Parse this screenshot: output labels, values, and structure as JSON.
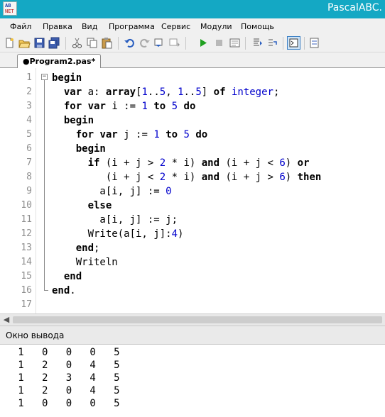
{
  "window": {
    "title": "PascalABC.",
    "icon_text_top": "AB",
    "icon_text_bottom": "NET"
  },
  "menu": [
    {
      "label": "Файл"
    },
    {
      "label": "Правка"
    },
    {
      "label": "Вид"
    },
    {
      "label": "Программа"
    },
    {
      "label": "Сервис"
    },
    {
      "label": "Модули"
    },
    {
      "label": "Помощь"
    }
  ],
  "toolbar": [
    {
      "icon": "new-file-icon"
    },
    {
      "icon": "open-folder-icon"
    },
    {
      "icon": "save-icon"
    },
    {
      "icon": "save-all-icon"
    },
    {
      "icon": "cut-icon"
    },
    {
      "icon": "copy-icon"
    },
    {
      "icon": "paste-icon"
    },
    {
      "icon": "undo-icon"
    },
    {
      "icon": "redo-icon"
    },
    {
      "icon": "indent-icon"
    },
    {
      "icon": "unindent-icon"
    },
    {
      "icon": "run-icon"
    },
    {
      "icon": "stop-icon"
    },
    {
      "icon": "compile-icon"
    },
    {
      "icon": "step-over-icon"
    },
    {
      "icon": "step-into-icon"
    },
    {
      "icon": "output-window-icon"
    },
    {
      "icon": "form-designer-icon"
    }
  ],
  "tab": {
    "label": "●Program2.pas*"
  },
  "editor": {
    "line_numbers": [
      "1",
      "2",
      "3",
      "4",
      "5",
      "6",
      "7",
      "8",
      "9",
      "10",
      "11",
      "12",
      "13",
      "14",
      "15",
      "16",
      "17"
    ],
    "lines": [
      "begin",
      "  var a: array[1..5, 1..5] of integer;",
      "  for var i := 1 to 5 do",
      "  begin",
      "    for var j := 1 to 5 do",
      "    begin",
      "      if (i + j > 2 * i) and (i + j < 6) or",
      "         (i + j < 2 * i) and (i + j > 6) then",
      "        a[i, j] := 0",
      "      else",
      "        a[i, j] := j;",
      "      Write(a[i, j]:4)",
      "    end;",
      "    Writeln",
      "  end",
      "end.",
      ""
    ]
  },
  "output": {
    "title": "Окно вывода",
    "lines": [
      "   1   0   0   0   5",
      "   1   2   0   4   5",
      "   1   2   3   4   5",
      "   1   2   0   4   5",
      "   1   0   0   0   5"
    ]
  },
  "colors": {
    "titlebar": "#14a8c4",
    "keyword": "#000000",
    "number": "#0000cc"
  }
}
